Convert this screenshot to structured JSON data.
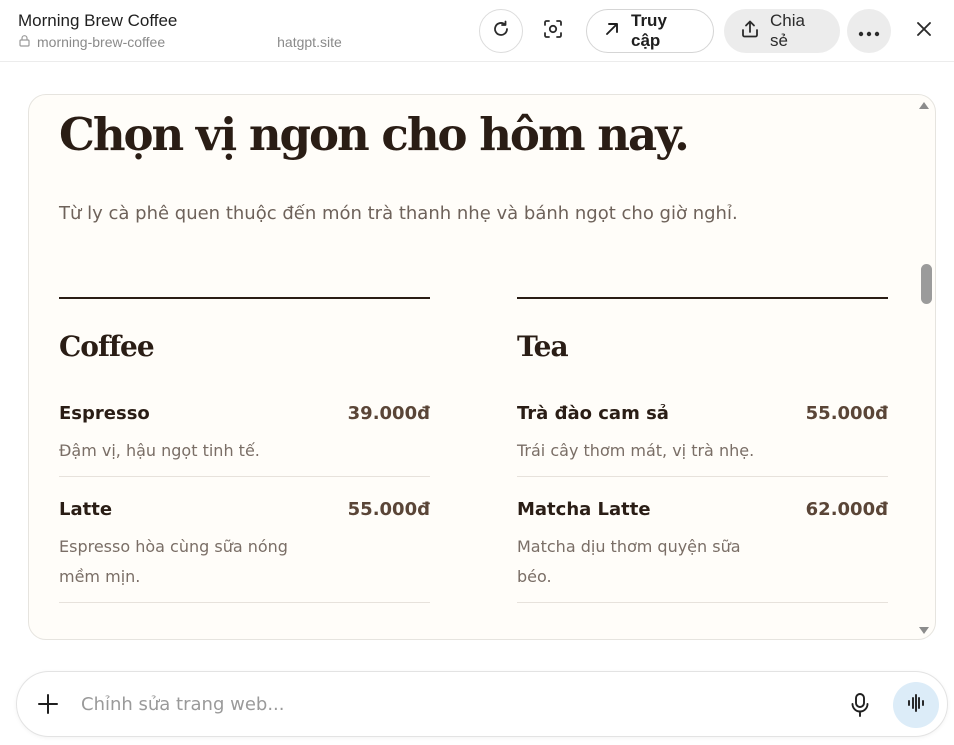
{
  "header": {
    "title": "Morning Brew Coffee",
    "url_start": "morning-brew-coffee",
    "url_end": "hatgpt.site",
    "open_label": "Truy cập",
    "share_label": "Chia sẻ"
  },
  "page": {
    "hero_title": "Chọn vị ngon cho hôm nay.",
    "hero_subtitle": "Từ ly cà phê quen thuộc đến món trà thanh nhẹ và bánh ngọt cho giờ nghỉ.",
    "columns": [
      {
        "title": "Coffee",
        "items": [
          {
            "name": "Espresso",
            "price": "39.000đ",
            "desc": "Đậm vị, hậu ngọt tinh tế."
          },
          {
            "name": "Latte",
            "price": "55.000đ",
            "desc": "Espresso hòa cùng sữa nóng mềm mịn."
          }
        ]
      },
      {
        "title": "Tea",
        "items": [
          {
            "name": "Trà đào cam sả",
            "price": "55.000đ",
            "desc": "Trái cây thơm mát, vị trà nhẹ."
          },
          {
            "name": "Matcha Latte",
            "price": "62.000đ",
            "desc": "Matcha dịu thơm quyện sữa béo."
          }
        ]
      }
    ]
  },
  "composer": {
    "placeholder": "Chỉnh sửa trang web..."
  },
  "icons": {
    "lock": "lock-icon",
    "reload": "reload-icon",
    "screenshot": "screenshot-icon",
    "open": "arrow-up-right-icon",
    "share": "share-icon",
    "more": "more-icon",
    "close": "close-icon",
    "plus": "plus-icon",
    "mic": "mic-icon",
    "voice": "voice-wave-icon"
  },
  "colors": {
    "heading": "#2a1d15",
    "price": "#5a4537",
    "page_bg": "#fffdf9",
    "voice_bg": "#dcecf8"
  }
}
